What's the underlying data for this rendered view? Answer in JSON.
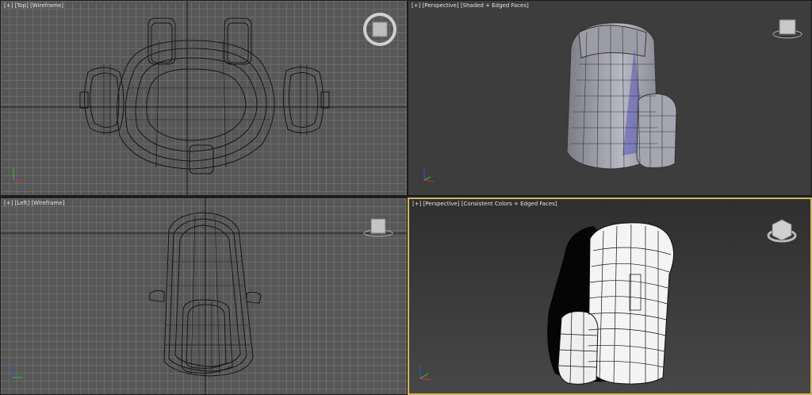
{
  "viewports": {
    "top_left": {
      "plus": "[+]",
      "view": "[Top]",
      "mode": "[Wireframe]"
    },
    "top_right": {
      "plus": "[+]",
      "view": "[Perspective]",
      "mode": "[Shaded + Edged Faces]"
    },
    "bottom_left": {
      "plus": "[+]",
      "view": "[Left]",
      "mode": "[Wireframe]"
    },
    "bottom_right": {
      "plus": "[+]",
      "view": "[Perspective]",
      "mode": "[Consistent Colors + Edged Faces]"
    }
  },
  "icons": {
    "viewcube": "viewcube-icon",
    "axis_tripod": "axis-tripod-icon"
  },
  "colors": {
    "active_viewport_border": "#d3b55f",
    "wire": "#111111",
    "axis_x": "#d83030",
    "axis_y": "#30c030",
    "axis_z": "#3050e0"
  }
}
